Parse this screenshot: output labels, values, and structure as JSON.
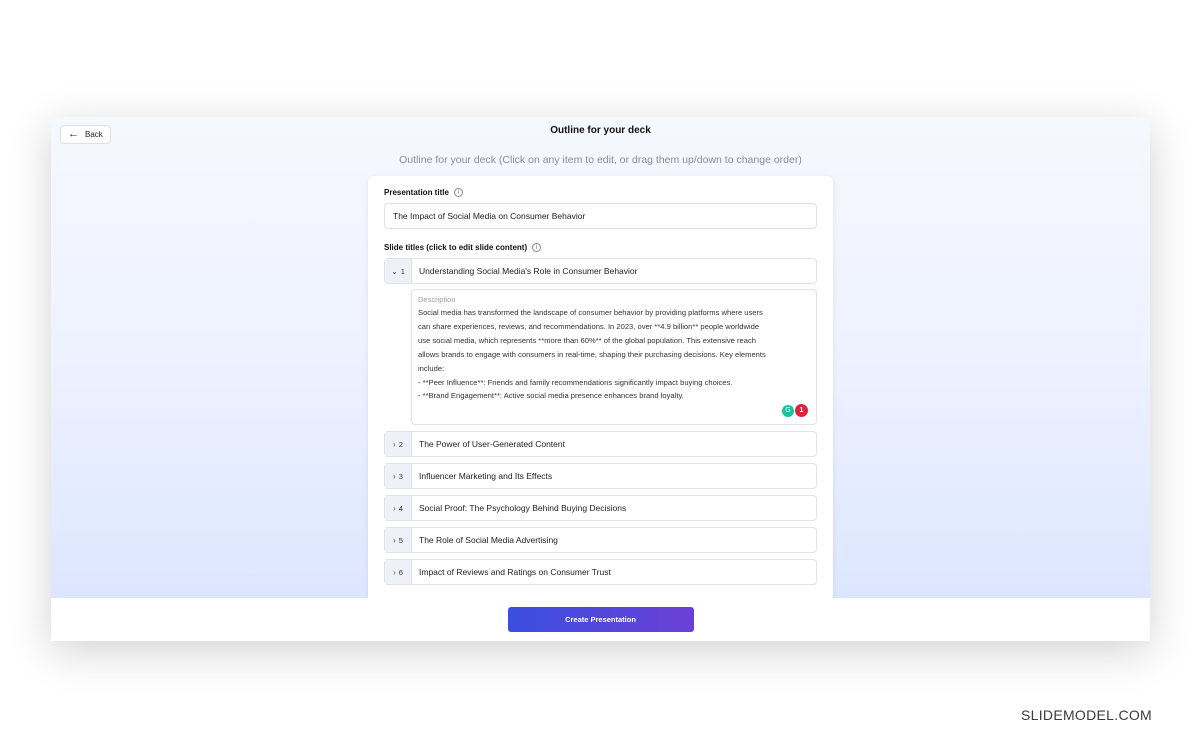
{
  "header": {
    "back_label": "Back",
    "title": "Outline for your deck"
  },
  "subtitle": "Outline for your deck (Click on any item to edit, or drag them up/down to change order)",
  "presentation": {
    "title_label": "Presentation title",
    "title_value": "The Impact of Social Media on Consumer Behavior",
    "slides_label": "Slide titles (click to edit slide content)"
  },
  "slides": [
    {
      "num": "1",
      "chevron": "⌄",
      "title": "Understanding Social Media's Role in Consumer Behavior"
    },
    {
      "num": "2",
      "chevron": "›",
      "title": "The Power of User-Generated Content"
    },
    {
      "num": "3",
      "chevron": "›",
      "title": "Influencer Marketing and Its Effects"
    },
    {
      "num": "4",
      "chevron": "›",
      "title": "Social Proof: The Psychology Behind Buying Decisions"
    },
    {
      "num": "5",
      "chevron": "›",
      "title": "The Role of Social Media Advertising"
    },
    {
      "num": "6",
      "chevron": "›",
      "title": "Impact of Reviews and Ratings on Consumer Trust"
    }
  ],
  "description": {
    "label": "Description",
    "lines": [
      "Social media has transformed the landscape of consumer behavior by providing platforms where users",
      "can share experiences, reviews, and recommendations. In 2023, over **4.9 billion** people worldwide",
      "use social media, which represents **more than 60%** of the global population. This extensive reach",
      "allows brands to engage with consumers in real-time, shaping their purchasing decisions. Key elements",
      "include:",
      "- **Peer Influence**: Friends and family recommendations significantly impact buying choices.",
      "- **Brand Engagement**: Active social media presence enhances brand loyalty."
    ],
    "issue_count": "1"
  },
  "footer": {
    "create_label": "Create Presentation"
  },
  "watermark": "SLIDEMODEL.COM",
  "colors": {
    "accent_start": "#3a4fe0",
    "accent_end": "#6b3fd6",
    "badge_red": "#d7263d",
    "grammarly_green": "#15c39a"
  },
  "icons": {
    "back": "arrow-left-icon",
    "info": "info-icon",
    "expand": "chevron-down-icon",
    "collapse": "chevron-right-icon"
  }
}
